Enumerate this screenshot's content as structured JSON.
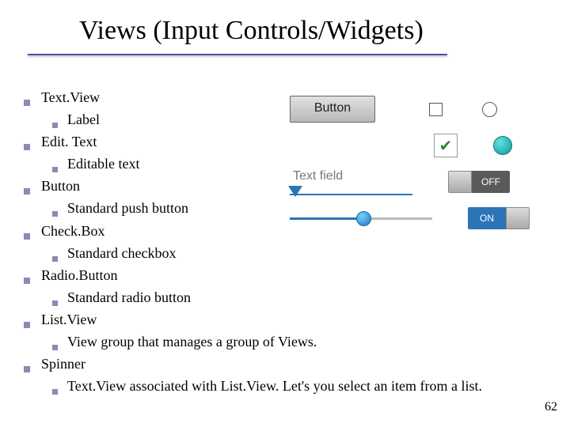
{
  "title": "Views (Input Controls/Widgets)",
  "page_number": "62",
  "bullets": [
    {
      "label": "Text.View",
      "sub": "Label"
    },
    {
      "label": "Edit. Text",
      "sub": "Editable text"
    },
    {
      "label": "Button",
      "sub": "Standard push button"
    },
    {
      "label": "Check.Box",
      "sub": "Standard checkbox"
    },
    {
      "label": "Radio.Button",
      "sub": "Standard radio button"
    },
    {
      "label": "List.View",
      "sub": "View group that manages a group of Views."
    },
    {
      "label": "Spinner",
      "sub": "Text.View associated with List.View. Let's you select an item from a list."
    }
  ],
  "widgets": {
    "button_label": "Button",
    "textfield_placeholder": "Text field",
    "toggle_off": "OFF",
    "toggle_on": "ON"
  }
}
